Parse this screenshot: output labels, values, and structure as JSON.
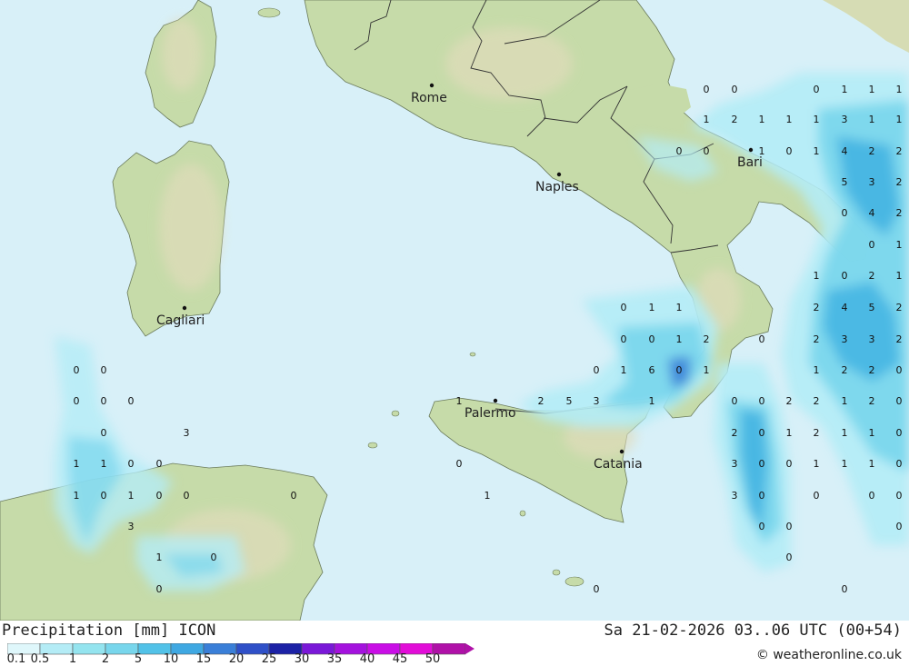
{
  "header": {
    "product": "Precipitation [mm] ICON",
    "valid_time": "Sa 21-02-2026 03..06 UTC (00+54)",
    "credit": "© weatheronline.co.uk"
  },
  "colors": {
    "sea": "#d8f0f8",
    "land": "#c6dba9",
    "border": "#333333",
    "precip_light": "#b4ecf6",
    "precip_mid": "#78d6ec",
    "precip_heavy": "#3fb2e2",
    "precip_max": "#3a7fd8"
  },
  "legend": {
    "labels": [
      "0.1",
      "0.5",
      "1",
      "2",
      "5",
      "10",
      "15",
      "20",
      "25",
      "30",
      "35",
      "40",
      "45",
      "50"
    ],
    "colors": [
      "#dff7fb",
      "#b4ecf6",
      "#94e4ef",
      "#78d6ec",
      "#52c2e8",
      "#3fa8e2",
      "#3a7fd8",
      "#2f50c8",
      "#1c22a6",
      "#7a18d8",
      "#a412de",
      "#c90ee6",
      "#e20dd8",
      "#b011a8"
    ]
  },
  "cities": [
    {
      "name": "Rome"
    },
    {
      "name": "Naples"
    },
    {
      "name": "Bari"
    },
    {
      "name": "Cagliari"
    },
    {
      "name": "Palermo"
    },
    {
      "name": "Catania"
    }
  ],
  "values": [
    "0",
    "0",
    "0",
    "1",
    "1",
    "1",
    "1",
    "2",
    "1",
    "1",
    "1",
    "3",
    "1",
    "1",
    "0",
    "0",
    "1",
    "0",
    "1",
    "4",
    "2",
    "2",
    "5",
    "3",
    "2",
    "0",
    "4",
    "2",
    "0",
    "1",
    "1",
    "0",
    "2",
    "1",
    "0",
    "1",
    "1",
    "2",
    "4",
    "5",
    "2",
    "0",
    "0",
    "1",
    "2",
    "0",
    "2",
    "3",
    "3",
    "2",
    "0",
    "0",
    "0",
    "1",
    "6",
    "0",
    "1",
    "1",
    "2",
    "2",
    "0",
    "0",
    "0",
    "0",
    "1",
    "2",
    "5",
    "3",
    "1",
    "0",
    "0",
    "2",
    "2",
    "1",
    "2",
    "0",
    "0",
    "3",
    "2",
    "0",
    "1",
    "2",
    "1",
    "1",
    "0",
    "1",
    "1",
    "0",
    "0",
    "0",
    "3",
    "0",
    "0",
    "1",
    "1",
    "1",
    "0",
    "1",
    "0",
    "1",
    "0",
    "0",
    "0",
    "1",
    "3",
    "0",
    "0",
    "0",
    "0",
    "3",
    "0",
    "0",
    "0",
    "1",
    "0",
    "0",
    "0",
    "0",
    "0"
  ]
}
